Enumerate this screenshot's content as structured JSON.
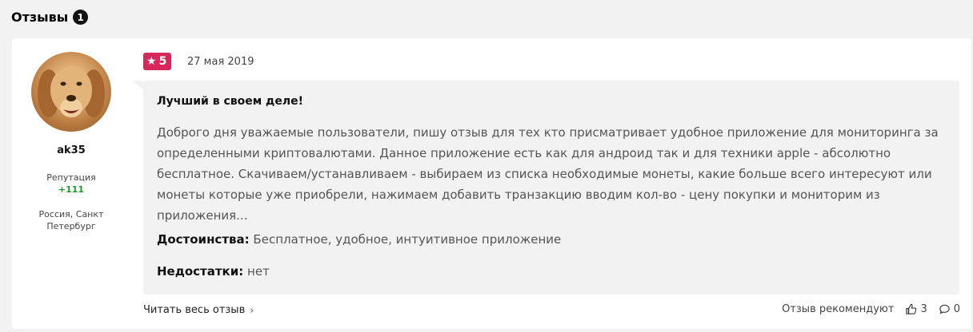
{
  "section": {
    "title": "Отзывы",
    "count": "1"
  },
  "author": {
    "name": "ak35",
    "reputation_label": "Репутация",
    "reputation_value": "+111",
    "location": "Россия, Санкт Петербург"
  },
  "review": {
    "rating": "5",
    "date": "27 мая 2019",
    "title": "Лучший в своем деле!",
    "body": "Доброго дня уважаемые пользователи, пишу отзыв для тех кто присматривает удобное приложение для мониторинга за определенными криптовалютами. Данное приложение есть как для андроид так и для техники apple - абсолютно бесплатное. Скачиваем/устанавливаем - выбираем из списка необходимые монеты, какие больше всего интересуют или монеты которые уже приобрели, нажимаем добавить транзакцию вводим кол-во - цену покупки и мониторим из приложения...",
    "pros_label": "Достоинства:",
    "pros_text": "Бесплатное, удобное, интуитивное приложение",
    "cons_label": "Недостатки:",
    "cons_text": "нет"
  },
  "footer": {
    "read_more": "Читать весь отзыв",
    "recommend": "Отзыв рекомендуют",
    "likes": "3",
    "comments": "0"
  },
  "colors": {
    "rating_badge": "#d6285a",
    "reputation": "#1a9b2a"
  },
  "icons": {
    "rating": "star-icon",
    "read_more": "chevron-right-icon",
    "likes": "thumbs-up-icon",
    "comments": "comment-icon"
  }
}
